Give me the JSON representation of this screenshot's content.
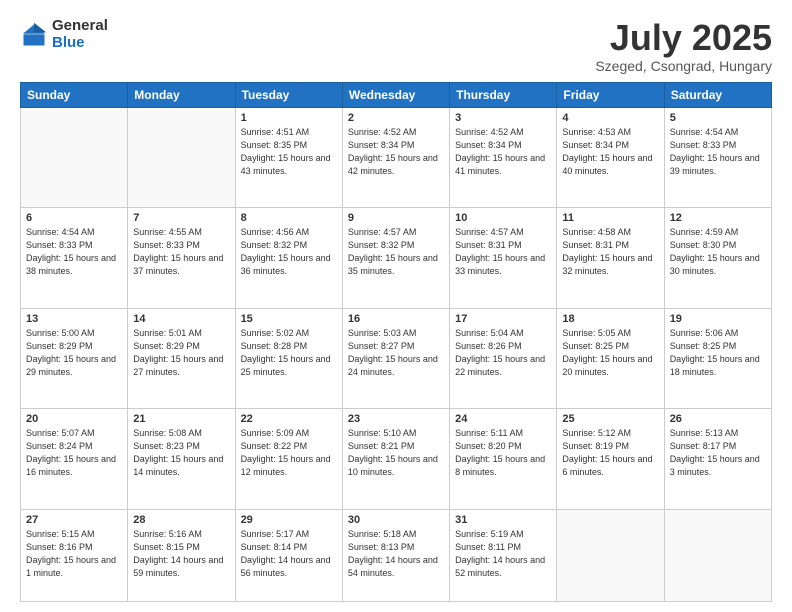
{
  "logo": {
    "general": "General",
    "blue": "Blue"
  },
  "header": {
    "month": "July 2025",
    "location": "Szeged, Csongrad, Hungary"
  },
  "weekdays": [
    "Sunday",
    "Monday",
    "Tuesday",
    "Wednesday",
    "Thursday",
    "Friday",
    "Saturday"
  ],
  "weeks": [
    [
      {
        "day": "",
        "info": ""
      },
      {
        "day": "",
        "info": ""
      },
      {
        "day": "1",
        "info": "Sunrise: 4:51 AM\nSunset: 8:35 PM\nDaylight: 15 hours and 43 minutes."
      },
      {
        "day": "2",
        "info": "Sunrise: 4:52 AM\nSunset: 8:34 PM\nDaylight: 15 hours and 42 minutes."
      },
      {
        "day": "3",
        "info": "Sunrise: 4:52 AM\nSunset: 8:34 PM\nDaylight: 15 hours and 41 minutes."
      },
      {
        "day": "4",
        "info": "Sunrise: 4:53 AM\nSunset: 8:34 PM\nDaylight: 15 hours and 40 minutes."
      },
      {
        "day": "5",
        "info": "Sunrise: 4:54 AM\nSunset: 8:33 PM\nDaylight: 15 hours and 39 minutes."
      }
    ],
    [
      {
        "day": "6",
        "info": "Sunrise: 4:54 AM\nSunset: 8:33 PM\nDaylight: 15 hours and 38 minutes."
      },
      {
        "day": "7",
        "info": "Sunrise: 4:55 AM\nSunset: 8:33 PM\nDaylight: 15 hours and 37 minutes."
      },
      {
        "day": "8",
        "info": "Sunrise: 4:56 AM\nSunset: 8:32 PM\nDaylight: 15 hours and 36 minutes."
      },
      {
        "day": "9",
        "info": "Sunrise: 4:57 AM\nSunset: 8:32 PM\nDaylight: 15 hours and 35 minutes."
      },
      {
        "day": "10",
        "info": "Sunrise: 4:57 AM\nSunset: 8:31 PM\nDaylight: 15 hours and 33 minutes."
      },
      {
        "day": "11",
        "info": "Sunrise: 4:58 AM\nSunset: 8:31 PM\nDaylight: 15 hours and 32 minutes."
      },
      {
        "day": "12",
        "info": "Sunrise: 4:59 AM\nSunset: 8:30 PM\nDaylight: 15 hours and 30 minutes."
      }
    ],
    [
      {
        "day": "13",
        "info": "Sunrise: 5:00 AM\nSunset: 8:29 PM\nDaylight: 15 hours and 29 minutes."
      },
      {
        "day": "14",
        "info": "Sunrise: 5:01 AM\nSunset: 8:29 PM\nDaylight: 15 hours and 27 minutes."
      },
      {
        "day": "15",
        "info": "Sunrise: 5:02 AM\nSunset: 8:28 PM\nDaylight: 15 hours and 25 minutes."
      },
      {
        "day": "16",
        "info": "Sunrise: 5:03 AM\nSunset: 8:27 PM\nDaylight: 15 hours and 24 minutes."
      },
      {
        "day": "17",
        "info": "Sunrise: 5:04 AM\nSunset: 8:26 PM\nDaylight: 15 hours and 22 minutes."
      },
      {
        "day": "18",
        "info": "Sunrise: 5:05 AM\nSunset: 8:25 PM\nDaylight: 15 hours and 20 minutes."
      },
      {
        "day": "19",
        "info": "Sunrise: 5:06 AM\nSunset: 8:25 PM\nDaylight: 15 hours and 18 minutes."
      }
    ],
    [
      {
        "day": "20",
        "info": "Sunrise: 5:07 AM\nSunset: 8:24 PM\nDaylight: 15 hours and 16 minutes."
      },
      {
        "day": "21",
        "info": "Sunrise: 5:08 AM\nSunset: 8:23 PM\nDaylight: 15 hours and 14 minutes."
      },
      {
        "day": "22",
        "info": "Sunrise: 5:09 AM\nSunset: 8:22 PM\nDaylight: 15 hours and 12 minutes."
      },
      {
        "day": "23",
        "info": "Sunrise: 5:10 AM\nSunset: 8:21 PM\nDaylight: 15 hours and 10 minutes."
      },
      {
        "day": "24",
        "info": "Sunrise: 5:11 AM\nSunset: 8:20 PM\nDaylight: 15 hours and 8 minutes."
      },
      {
        "day": "25",
        "info": "Sunrise: 5:12 AM\nSunset: 8:19 PM\nDaylight: 15 hours and 6 minutes."
      },
      {
        "day": "26",
        "info": "Sunrise: 5:13 AM\nSunset: 8:17 PM\nDaylight: 15 hours and 3 minutes."
      }
    ],
    [
      {
        "day": "27",
        "info": "Sunrise: 5:15 AM\nSunset: 8:16 PM\nDaylight: 15 hours and 1 minute."
      },
      {
        "day": "28",
        "info": "Sunrise: 5:16 AM\nSunset: 8:15 PM\nDaylight: 14 hours and 59 minutes."
      },
      {
        "day": "29",
        "info": "Sunrise: 5:17 AM\nSunset: 8:14 PM\nDaylight: 14 hours and 56 minutes."
      },
      {
        "day": "30",
        "info": "Sunrise: 5:18 AM\nSunset: 8:13 PM\nDaylight: 14 hours and 54 minutes."
      },
      {
        "day": "31",
        "info": "Sunrise: 5:19 AM\nSunset: 8:11 PM\nDaylight: 14 hours and 52 minutes."
      },
      {
        "day": "",
        "info": ""
      },
      {
        "day": "",
        "info": ""
      }
    ]
  ]
}
